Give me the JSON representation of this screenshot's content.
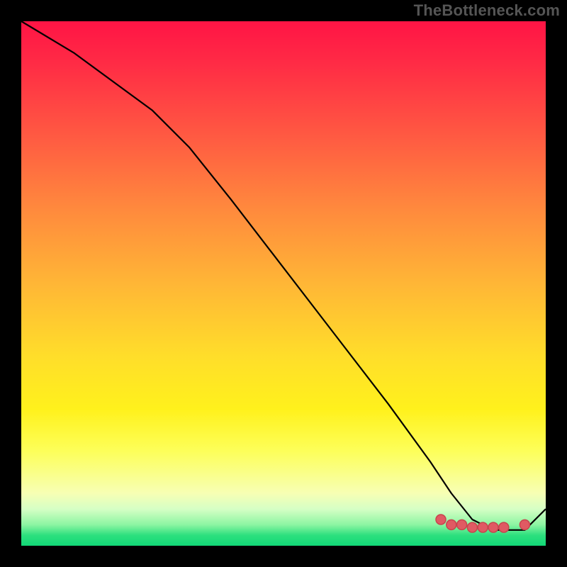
{
  "watermark": "TheBottleneck.com",
  "colors": {
    "black": "#000000",
    "marker": "#e05a63",
    "curve": "#000000"
  },
  "chart_data": {
    "type": "line",
    "title": "",
    "xlabel": "",
    "ylabel": "",
    "xlim": [
      0,
      100
    ],
    "ylim": [
      0,
      100
    ],
    "series": [
      {
        "name": "curve",
        "x": [
          0,
          10,
          25,
          32,
          40,
          50,
          60,
          70,
          78,
          82,
          86,
          90,
          94,
          96,
          100
        ],
        "y": [
          100,
          94,
          83,
          76,
          66,
          53,
          40,
          27,
          16,
          10,
          5,
          3,
          3,
          3,
          7
        ]
      }
    ],
    "markers": [
      {
        "x": 80,
        "y": 5
      },
      {
        "x": 82,
        "y": 4
      },
      {
        "x": 84,
        "y": 4
      },
      {
        "x": 86,
        "y": 3.5
      },
      {
        "x": 88,
        "y": 3.5
      },
      {
        "x": 90,
        "y": 3.5
      },
      {
        "x": 92,
        "y": 3.5
      },
      {
        "x": 96,
        "y": 4
      }
    ],
    "gradient_stops_pct": [
      0,
      8,
      22,
      36,
      50,
      64,
      74,
      82,
      90,
      93,
      96,
      98,
      100
    ],
    "gradient_colors": [
      "#ff1445",
      "#ff2b45",
      "#ff5a42",
      "#ff8a3d",
      "#ffb636",
      "#ffde2a",
      "#fff11c",
      "#fdff5a",
      "#f7ffb4",
      "#d6ffc5",
      "#8cf5a2",
      "#2de07e",
      "#12d877"
    ]
  }
}
